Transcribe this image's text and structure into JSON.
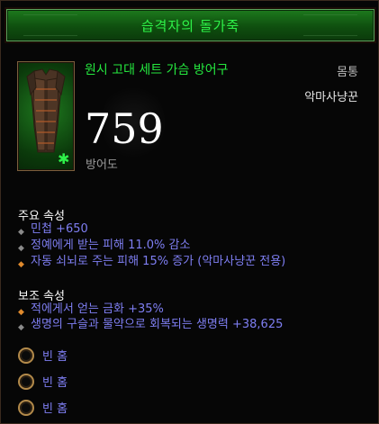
{
  "title": "습격자의 돌가죽",
  "item": {
    "name": "원시 고대 세트 가슴 방어구",
    "slot": "몸통",
    "class": "악마사냥꾼",
    "armor_value": "759",
    "armor_label": "방어도"
  },
  "primary": {
    "title": "주요 속성",
    "stats": [
      "민첩 +650",
      "정예에게 받는 피해 11.0% 감소",
      "자동 쇠뇌로 주는 피해 15% 증가 (악마사냥꾼 전용)"
    ]
  },
  "secondary": {
    "title": "보조 속성",
    "stats": [
      "적에게서 얻는 금화 +35%",
      "생명의 구슬과 물약으로 회복되는 생명력 +38,625"
    ]
  },
  "sockets": [
    "빈 홈",
    "빈 홈",
    "빈 홈"
  ],
  "colors": {
    "set_green": "#25e83f",
    "magic_blue": "#7e7ef2",
    "legendary_orange": "#e08a2d"
  }
}
